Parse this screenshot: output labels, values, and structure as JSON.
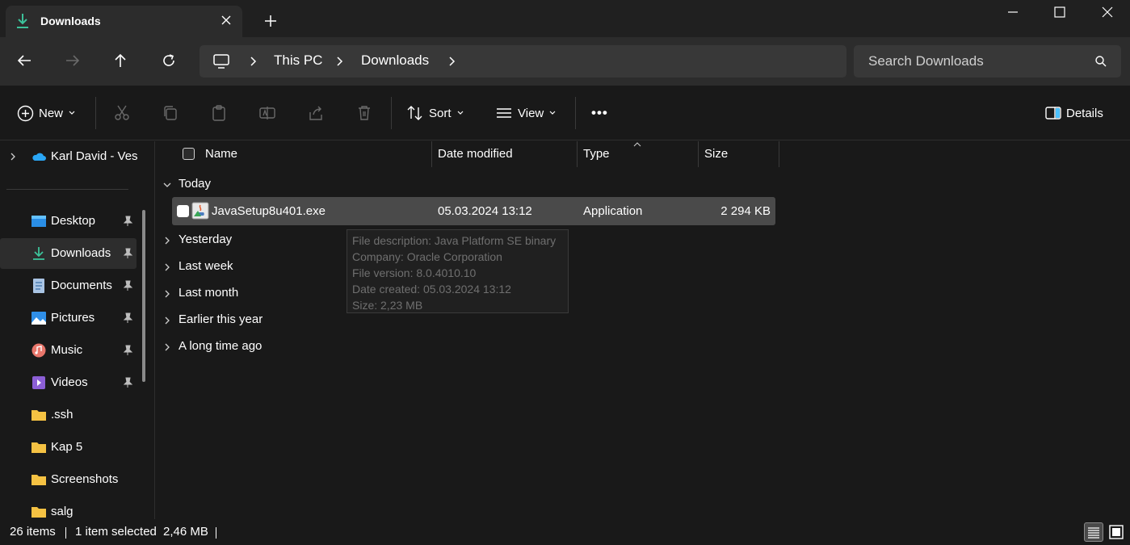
{
  "colors": {
    "accent": "#4cc2ff",
    "folder": "#f5c243",
    "download_green": "#3cc29a"
  },
  "window": {
    "tab_title": "Downloads",
    "tab_icon": "download-icon",
    "new_tab_icon": "plus-icon",
    "minimize_icon": "minimize-icon",
    "maximize_icon": "maximize-icon",
    "close_icon": "close-icon"
  },
  "nav": {
    "back_icon": "arrow-left-icon",
    "forward_icon": "arrow-right-icon",
    "up_icon": "arrow-up-icon",
    "refresh_icon": "refresh-icon"
  },
  "address": {
    "root_icon": "computer-icon",
    "breadcrumb": [
      "This PC",
      "Downloads"
    ]
  },
  "search": {
    "placeholder": "Search Downloads",
    "icon": "search-icon"
  },
  "toolbar": {
    "new_label": "New",
    "sort_label": "Sort",
    "view_label": "View",
    "more_label": "•••",
    "details_label": "Details",
    "icons": [
      "cut-icon",
      "copy-icon",
      "paste-icon",
      "rename-icon",
      "share-icon",
      "delete-icon"
    ]
  },
  "sidebar": {
    "cloud": {
      "label": "Karl David - Ves",
      "icon": "onedrive-icon"
    },
    "items": [
      {
        "label": "Desktop",
        "icon": "desktop-icon",
        "pinned": true
      },
      {
        "label": "Downloads",
        "icon": "download-icon",
        "pinned": true,
        "active": true
      },
      {
        "label": "Documents",
        "icon": "documents-icon",
        "pinned": true
      },
      {
        "label": "Pictures",
        "icon": "pictures-icon",
        "pinned": true
      },
      {
        "label": "Music",
        "icon": "music-icon",
        "pinned": true
      },
      {
        "label": "Videos",
        "icon": "videos-icon",
        "pinned": true
      },
      {
        "label": ".ssh",
        "icon": "folder-icon",
        "pinned": false
      },
      {
        "label": "Kap 5",
        "icon": "folder-icon",
        "pinned": false
      },
      {
        "label": "Screenshots",
        "icon": "folder-icon",
        "pinned": false
      },
      {
        "label": "salg",
        "icon": "folder-icon",
        "pinned": false
      }
    ]
  },
  "columns": {
    "name": "Name",
    "date": "Date modified",
    "type": "Type",
    "size": "Size"
  },
  "groups": {
    "today": "Today",
    "collapsed": [
      "Yesterday",
      "Last week",
      "Last month",
      "Earlier this year",
      "A long time ago"
    ]
  },
  "file": {
    "name": "JavaSetup8u401.exe",
    "date": "05.03.2024 13:12",
    "type": "Application",
    "size": "2 294 KB",
    "icon": "java-installer-icon"
  },
  "tooltip": {
    "lines": [
      "File description: Java Platform SE binary",
      "Company: Oracle Corporation",
      "File version: 8.0.4010.10",
      "Date created: 05.03.2024 13:12",
      "Size: 2,23 MB"
    ]
  },
  "status": {
    "items": "26 items",
    "selected": "1 item selected",
    "size": "2,46 MB",
    "details_view_icon": "details-view-icon",
    "tiles_view_icon": "large-icons-view-icon"
  }
}
